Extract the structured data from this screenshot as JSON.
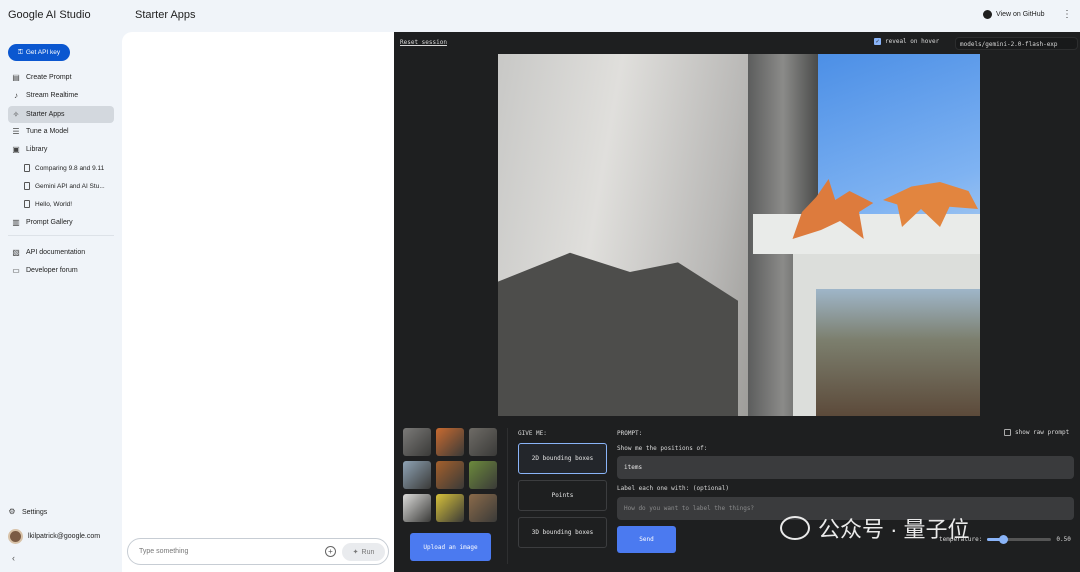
{
  "app": {
    "logo": "Google AI Studio",
    "page_title": "Starter Apps",
    "github_label": "View on GitHub"
  },
  "sidebar": {
    "api_key_label": "Get API key",
    "items": [
      {
        "label": "Create Prompt",
        "icon": "create-prompt-icon"
      },
      {
        "label": "Stream Realtime",
        "icon": "microphone-icon"
      },
      {
        "label": "Starter Apps",
        "icon": "spark-icon",
        "active": true
      },
      {
        "label": "Tune a Model",
        "icon": "tune-icon"
      },
      {
        "label": "Library",
        "icon": "library-icon"
      }
    ],
    "library_items": [
      "Comparing 9.8 and 9.11",
      "Gemini API and AI Stu...",
      "Hello, World!"
    ],
    "prompt_gallery": "Prompt Gallery",
    "api_docs": "API documentation",
    "forum": "Developer forum",
    "settings": "Settings",
    "user_email": "lkilpatrick@google.com"
  },
  "middle": {
    "input_placeholder": "Type something",
    "run_label": "Run"
  },
  "right": {
    "reset_label": "Reset session",
    "reveal_label": "reveal on hover",
    "reveal_checked": true,
    "model": "models/gemini-2.0-flash-exp",
    "give_me_label": "GIVE ME:",
    "modes": [
      "2D bounding boxes",
      "Points",
      "3D bounding boxes"
    ],
    "active_mode": "2D bounding boxes",
    "prompt_label": "PROMPT:",
    "raw_prompt_label": "show raw prompt",
    "positions_label": "Show me the positions of:",
    "positions_value": "items",
    "label_label": "Label each one with: (optional)",
    "label_placeholder": "How do you want to label the things?",
    "send_label": "Send",
    "upload_label": "Upload an image",
    "temperature_label": "temperature:",
    "temperature_value": "0.50",
    "temperature_fraction": 0.25,
    "thumb_colors": [
      "#7b7a78",
      "#c86a30",
      "#6e6b66",
      "#8ea3b5",
      "#a4602c",
      "#6c8a3c",
      "#dcdcda",
      "#d6c13a",
      "#8a6a4a"
    ]
  },
  "watermark": {
    "text": "公众号 · 量子位"
  }
}
